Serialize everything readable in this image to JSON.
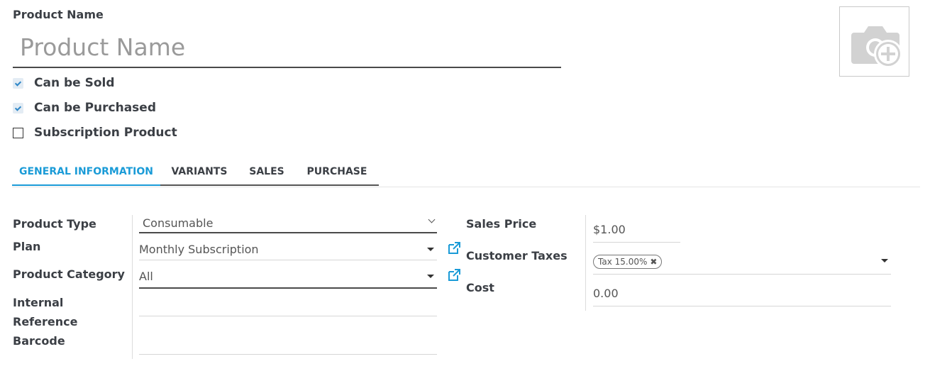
{
  "header": {
    "product_name_label": "Product Name",
    "product_name_placeholder": "Product Name",
    "product_name_value": ""
  },
  "options": [
    {
      "label": "Can be Sold",
      "checked": true
    },
    {
      "label": "Can be Purchased",
      "checked": true
    },
    {
      "label": "Subscription Product",
      "checked": false
    }
  ],
  "tabs": [
    {
      "label": "GENERAL INFORMATION",
      "active": true
    },
    {
      "label": "VARIANTS",
      "active": false
    },
    {
      "label": "SALES",
      "active": false
    },
    {
      "label": "PURCHASE",
      "active": false
    }
  ],
  "general": {
    "product_type_label": "Product Type",
    "product_type_value": "Consumable",
    "plan_label": "Plan",
    "plan_value": "Monthly Subscription",
    "category_label": "Product Category",
    "category_value": "All",
    "internal_reference_label_1": "Internal",
    "internal_reference_label_2": "Reference",
    "internal_reference_value": "",
    "barcode_label": "Barcode",
    "barcode_value": ""
  },
  "pricing": {
    "sales_price_label": "Sales Price",
    "sales_price_value": "$1.00",
    "customer_taxes_label": "Customer Taxes",
    "tax_tag": "Tax 15.00%",
    "tax_tag_remove": "✖",
    "cost_label": "Cost",
    "cost_value": "0.00"
  },
  "colors": {
    "accent": "#1a9bd7",
    "text": "#3b3f45",
    "link_icon": "#1a9bd7"
  },
  "icons": {
    "image_placeholder": "camera-plus-icon",
    "external_link": "external-link-icon",
    "dropdown": "caret-down-icon",
    "remove_tag": "close-icon"
  }
}
